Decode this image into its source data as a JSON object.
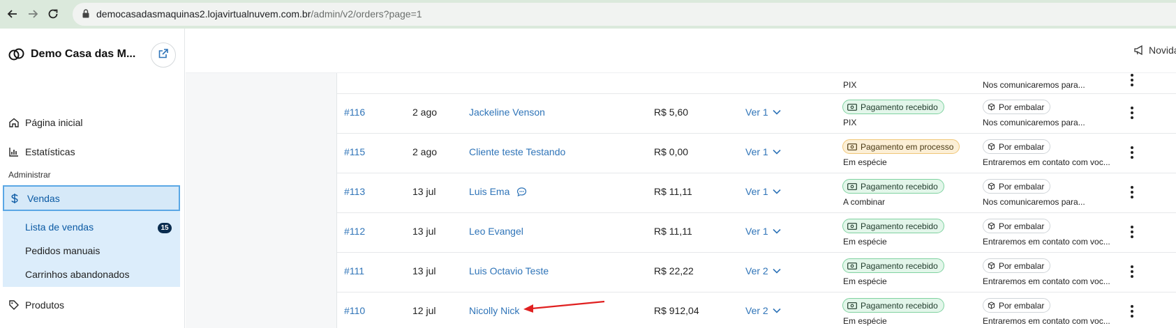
{
  "browser": {
    "url_host": "democasadasmaquinas2.lojavirtualnuvem.com.br",
    "url_path": "/admin/v2/orders?page=1"
  },
  "sidebar": {
    "store_name": "Demo Casa das M...",
    "items": [
      {
        "label": "Página inicial",
        "icon": "home-icon"
      },
      {
        "label": "Estatísticas",
        "icon": "bar-chart-icon"
      }
    ],
    "section_label": "Administrar",
    "vendas": {
      "label": "Vendas",
      "icon": "dollar-icon",
      "subitems": [
        {
          "label": "Lista de vendas",
          "badge": "15"
        },
        {
          "label": "Pedidos manuais"
        },
        {
          "label": "Carrinhos abandonados"
        }
      ]
    },
    "produtos": {
      "label": "Produtos",
      "icon": "tag-icon"
    }
  },
  "header": {
    "novidades_label": "Novida"
  },
  "orders": {
    "partial_top": {
      "payment_method": "PIX",
      "shipping_note": "Nos comunicaremos para..."
    },
    "rows": [
      {
        "number": "#116",
        "date": "2 ago",
        "client": "Jackeline Venson",
        "chat": false,
        "total": "R$ 5,60",
        "items": "Ver 1",
        "payment_status": "Pagamento recebido",
        "payment_kind": "ok",
        "payment_method": "PIX",
        "shipping_status": "Por embalar",
        "shipping_note": "Nos comunicaremos para..."
      },
      {
        "number": "#115",
        "date": "2 ago",
        "client": "Cliente teste Testando",
        "chat": false,
        "total": "R$ 0,00",
        "items": "Ver 1",
        "payment_status": "Pagamento em processo",
        "payment_kind": "proc",
        "payment_method": "Em espécie",
        "shipping_status": "Por embalar",
        "shipping_note": "Entraremos em contato com voc..."
      },
      {
        "number": "#113",
        "date": "13 jul",
        "client": "Luis Ema",
        "chat": true,
        "total": "R$ 11,11",
        "items": "Ver 1",
        "payment_status": "Pagamento recebido",
        "payment_kind": "ok",
        "payment_method": "A combinar",
        "shipping_status": "Por embalar",
        "shipping_note": "Nos comunicaremos para..."
      },
      {
        "number": "#112",
        "date": "13 jul",
        "client": "Leo Evangel",
        "chat": false,
        "total": "R$ 11,11",
        "items": "Ver 1",
        "payment_status": "Pagamento recebido",
        "payment_kind": "ok",
        "payment_method": "Em espécie",
        "shipping_status": "Por embalar",
        "shipping_note": "Entraremos em contato com voc..."
      },
      {
        "number": "#111",
        "date": "13 jul",
        "client": "Luis Octavio Teste",
        "chat": false,
        "total": "R$ 22,22",
        "items": "Ver 2",
        "payment_status": "Pagamento recebido",
        "payment_kind": "ok",
        "payment_method": "Em espécie",
        "shipping_status": "Por embalar",
        "shipping_note": "Entraremos em contato com voc..."
      },
      {
        "number": "#110",
        "date": "12 jul",
        "client": "Nicolly Nick",
        "chat": false,
        "total": "R$ 912,04",
        "items": "Ver 2",
        "payment_status": "Pagamento recebido",
        "payment_kind": "ok",
        "payment_method": "Em espécie",
        "shipping_status": "Por embalar",
        "shipping_note": "Entraremos em contato com voc..."
      }
    ]
  },
  "colors": {
    "link": "#2f74b8",
    "annotation_arrow": "#e02020"
  }
}
